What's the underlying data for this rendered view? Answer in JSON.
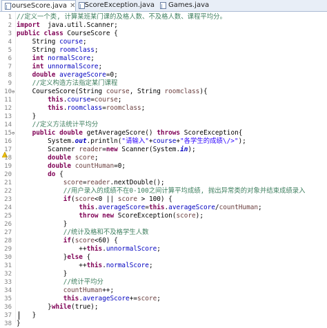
{
  "tabs": [
    {
      "label": "CourseScore.java",
      "active": true,
      "closable": true
    },
    {
      "label": "ScoreException.java",
      "active": false,
      "closable": false
    },
    {
      "label": "Games.java",
      "active": false,
      "closable": false
    }
  ],
  "close_glyph": "✕",
  "colors": {
    "keyword": "#7f0055",
    "field": "#0000c0",
    "comment": "#3f7f5f",
    "string": "#2a00ff",
    "local_variable": "#6a3e3e",
    "line_number": "#808080"
  },
  "line_numbers": [
    "1",
    "2",
    "3",
    "4",
    "5",
    "6",
    "7",
    "8",
    "9",
    "10",
    "11",
    "12",
    "13",
    "14",
    "15",
    "16",
    "17",
    "18",
    "19",
    "20",
    "21",
    "22",
    "23",
    "24",
    "25",
    "26",
    "27",
    "28",
    "29",
    "30",
    "31",
    "32",
    "33",
    "34",
    "35",
    "36",
    "37",
    "38"
  ],
  "fold_markers": {
    "10": "⊖",
    "15": "⊖"
  },
  "warning_lines": [
    "17"
  ],
  "code_lines": [
    [
      [
        "cm",
        "//定义一个类, 计算某班某门课的及格人数、不及格人数、课程平均分。"
      ]
    ],
    [
      [
        "kw",
        "import"
      ],
      [
        "",
        "  java.util.Scanner;"
      ]
    ],
    [
      [
        "kw",
        "public class"
      ],
      [
        "",
        " CourseScore {"
      ]
    ],
    [
      [
        "",
        "    String "
      ],
      [
        "fld",
        "course"
      ],
      [
        "",
        ";"
      ]
    ],
    [
      [
        "",
        "    String "
      ],
      [
        "fld",
        "roomclass"
      ],
      [
        "",
        ";"
      ]
    ],
    [
      [
        "",
        "    "
      ],
      [
        "kw",
        "int"
      ],
      [
        "",
        ""
      ],
      [
        "fld",
        " normalScore"
      ],
      [
        "",
        ";"
      ]
    ],
    [
      [
        "",
        "    "
      ],
      [
        "kw",
        "int"
      ],
      [
        "fld",
        " unnormalScore"
      ],
      [
        "",
        ";"
      ]
    ],
    [
      [
        "",
        "    "
      ],
      [
        "kw",
        "double"
      ],
      [
        "fld",
        " averageScore"
      ],
      [
        "",
        "=0;"
      ]
    ],
    [
      [
        "",
        "    "
      ],
      [
        "cm",
        "//定义构造方法指定某门课程"
      ]
    ],
    [
      [
        "",
        "    CourseScore(String "
      ],
      [
        "var",
        "course"
      ],
      [
        "",
        ", String "
      ],
      [
        "var",
        "roomclass"
      ],
      [
        "",
        "){"
      ]
    ],
    [
      [
        "",
        "        "
      ],
      [
        "kw",
        "this"
      ],
      [
        "",
        "."
      ],
      [
        "fld",
        "course"
      ],
      [
        "",
        "="
      ],
      [
        "var",
        "course"
      ],
      [
        "",
        ";"
      ]
    ],
    [
      [
        "",
        "        "
      ],
      [
        "kw",
        "this"
      ],
      [
        "",
        "."
      ],
      [
        "fld",
        "roomclass"
      ],
      [
        "",
        "="
      ],
      [
        "var",
        "roomclass"
      ],
      [
        "",
        ";"
      ]
    ],
    [
      [
        "",
        "    }"
      ]
    ],
    [
      [
        "",
        "    "
      ],
      [
        "cm",
        "//定义方法统计平均分"
      ]
    ],
    [
      [
        "",
        "    "
      ],
      [
        "kw",
        "public double"
      ],
      [
        "",
        " getAverageScore() "
      ],
      [
        "kw",
        "throws"
      ],
      [
        "",
        " ScoreException{"
      ]
    ],
    [
      [
        "",
        "        System."
      ],
      [
        "sfld",
        "out"
      ],
      [
        "",
        ".println("
      ],
      [
        "str",
        "\"请输入\""
      ],
      [
        "",
        "+"
      ],
      [
        "fld",
        "course"
      ],
      [
        "",
        "+"
      ],
      [
        "str",
        "\"各学生的成绩\\/>\""
      ],
      [
        "",
        ");"
      ]
    ],
    [
      [
        "",
        "        Scanner "
      ],
      [
        "var",
        "reader"
      ],
      [
        "",
        "="
      ],
      [
        "kw",
        "new"
      ],
      [
        "",
        " Scanner(System."
      ],
      [
        "sfld",
        "in"
      ],
      [
        "",
        ");"
      ]
    ],
    [
      [
        "",
        "        "
      ],
      [
        "kw",
        "double"
      ],
      [
        "",
        " "
      ],
      [
        "var",
        "score"
      ],
      [
        "",
        ";"
      ]
    ],
    [
      [
        "",
        "        "
      ],
      [
        "kw",
        "double"
      ],
      [
        "",
        " "
      ],
      [
        "var",
        "countHuman"
      ],
      [
        "",
        "=0;"
      ]
    ],
    [
      [
        "",
        "        "
      ],
      [
        "kw",
        "do"
      ],
      [
        "",
        " {"
      ]
    ],
    [
      [
        "",
        "            "
      ],
      [
        "var",
        "score"
      ],
      [
        "",
        "="
      ],
      [
        "var",
        "reader"
      ],
      [
        "",
        ".nextDouble();"
      ]
    ],
    [
      [
        "",
        "            "
      ],
      [
        "cm",
        "//用户录入的成绩不在0-100之间计算平均成绩, 抛出异常类的对象并结束成绩录入"
      ]
    ],
    [
      [
        "",
        "            "
      ],
      [
        "kw",
        "if"
      ],
      [
        "",
        "("
      ],
      [
        "var",
        "score"
      ],
      [
        "",
        "<0 || "
      ],
      [
        "var",
        "score"
      ],
      [
        "",
        " > 100) {"
      ]
    ],
    [
      [
        "",
        "                "
      ],
      [
        "kw",
        "this"
      ],
      [
        "",
        "."
      ],
      [
        "fld",
        "averageScore"
      ],
      [
        "",
        "="
      ],
      [
        "kw",
        "this"
      ],
      [
        "",
        "."
      ],
      [
        "fld",
        "averageScore"
      ],
      [
        "",
        "/"
      ],
      [
        "var",
        "countHuman"
      ],
      [
        "",
        ";"
      ]
    ],
    [
      [
        "",
        "                "
      ],
      [
        "kw",
        "throw new"
      ],
      [
        "",
        " ScoreException("
      ],
      [
        "var",
        "score"
      ],
      [
        "",
        ");"
      ]
    ],
    [
      [
        "",
        "            }"
      ]
    ],
    [
      [
        "",
        "            "
      ],
      [
        "cm",
        "//统计及格和不及格学生人数"
      ]
    ],
    [
      [
        "",
        "            "
      ],
      [
        "kw",
        "if"
      ],
      [
        "",
        "("
      ],
      [
        "var",
        "score"
      ],
      [
        "",
        "<60) {"
      ]
    ],
    [
      [
        "",
        "                ++"
      ],
      [
        "kw",
        "this"
      ],
      [
        "",
        "."
      ],
      [
        "fld",
        "unnormalScore"
      ],
      [
        "",
        ";"
      ]
    ],
    [
      [
        "",
        "            }"
      ],
      [
        "kw",
        "else"
      ],
      [
        "",
        " {"
      ]
    ],
    [
      [
        "",
        "                ++"
      ],
      [
        "kw",
        "this"
      ],
      [
        "",
        "."
      ],
      [
        "fld",
        "normalScore"
      ],
      [
        "",
        ";"
      ]
    ],
    [
      [
        "",
        "            }"
      ]
    ],
    [
      [
        "",
        "            "
      ],
      [
        "cm",
        "//统计平均分"
      ]
    ],
    [
      [
        "",
        "            "
      ],
      [
        "var",
        "countHuman"
      ],
      [
        "",
        "++;"
      ]
    ],
    [
      [
        "",
        "            "
      ],
      [
        "kw",
        "this"
      ],
      [
        "",
        "."
      ],
      [
        "fld",
        "averageScore"
      ],
      [
        "",
        "+="
      ],
      [
        "var",
        "score"
      ],
      [
        "",
        ";"
      ]
    ],
    [
      [
        "",
        "        }"
      ],
      [
        "kw",
        "while"
      ],
      [
        "",
        "(true);"
      ]
    ],
    [
      [
        "",
        "    }"
      ]
    ],
    [
      [
        "",
        "}"
      ]
    ]
  ]
}
